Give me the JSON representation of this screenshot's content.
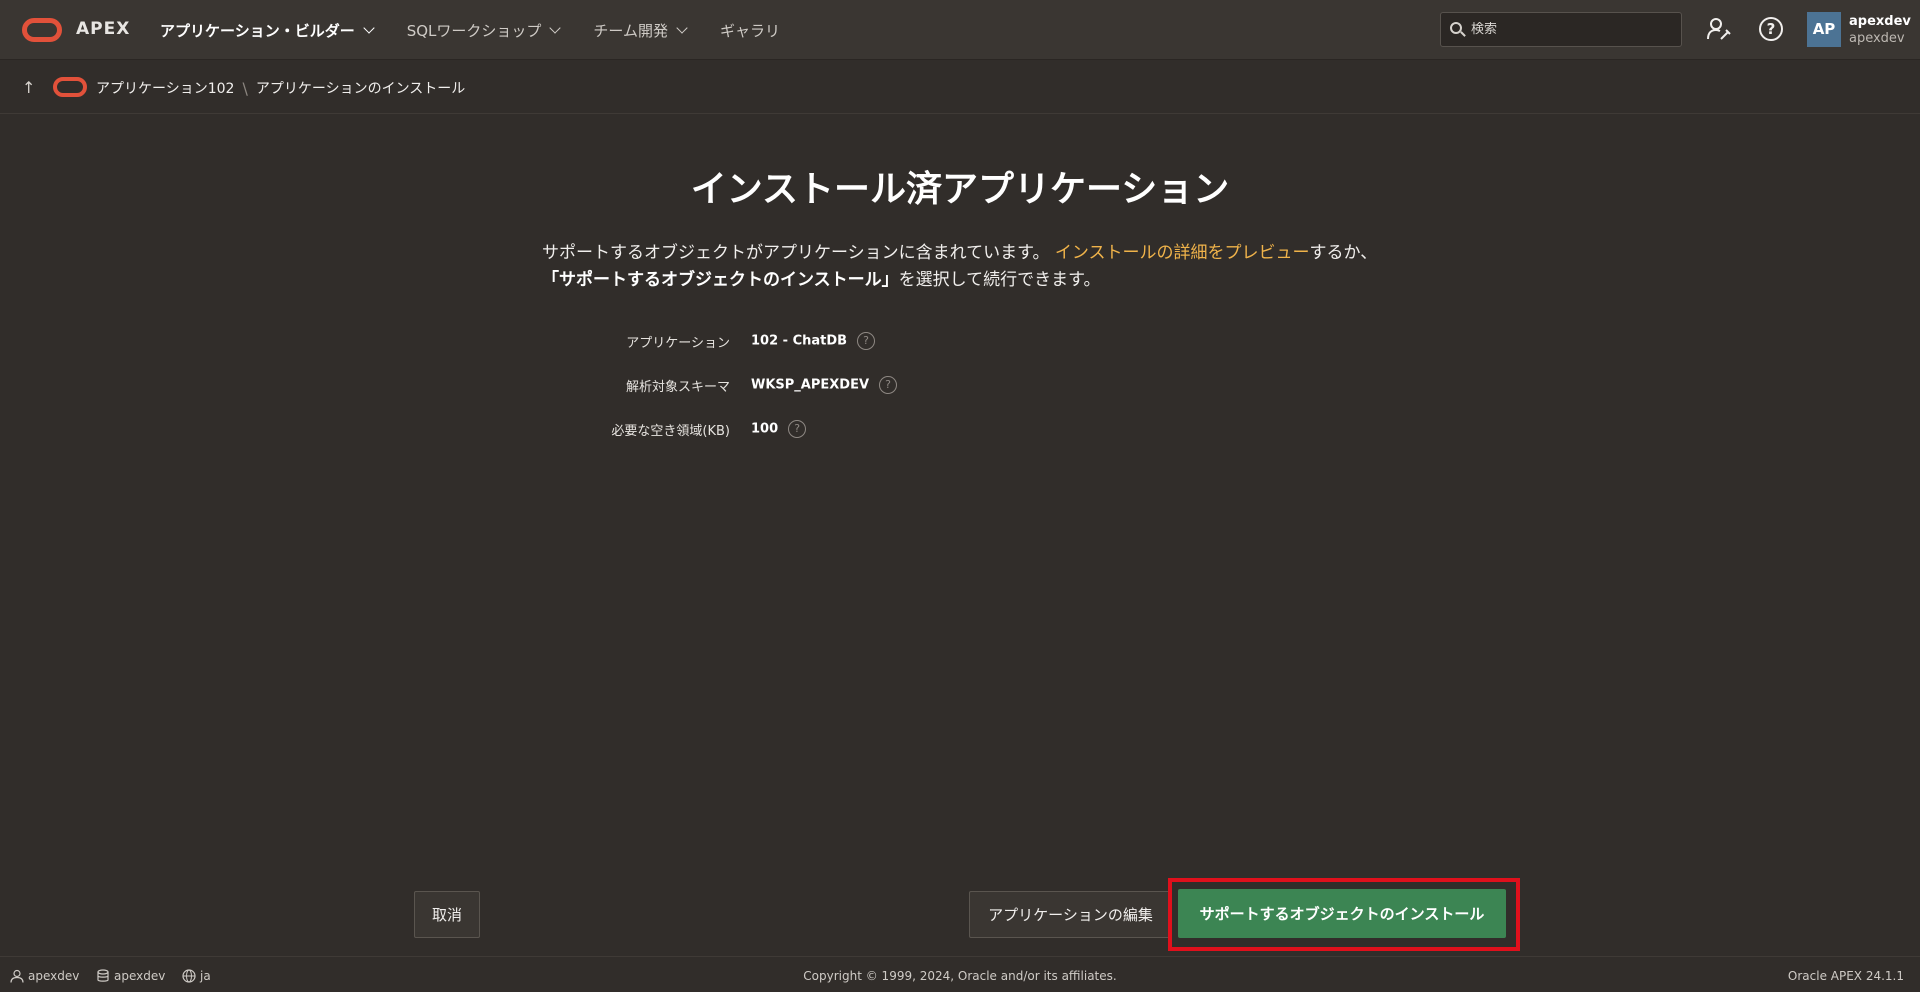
{
  "header": {
    "app_name": "APEX",
    "nav": [
      {
        "label": "アプリケーション・ビルダー"
      },
      {
        "label": "SQLワークショップ"
      },
      {
        "label": "チーム開発"
      },
      {
        "label": "ギャラリ"
      }
    ],
    "search_placeholder": "検索",
    "avatar_initials": "AP",
    "user_name": "apexdev",
    "workspace": "apexdev"
  },
  "breadcrumb": {
    "items": [
      "アプリケーション102",
      "アプリケーションのインストール"
    ]
  },
  "main": {
    "title": "インストール済アプリケーション",
    "desc_part1": "サポートするオブジェクトがアプリケーションに含まれています。",
    "desc_link": "インストールの詳細をプレビュー",
    "desc_part2": "するか、",
    "desc_strong": "「サポートするオブジェクトのインストール」",
    "desc_part3": "を選択して続行できます。",
    "fields": [
      {
        "label": "アプリケーション",
        "value": "102 - ChatDB"
      },
      {
        "label": "解析対象スキーマ",
        "value": "WKSP_APEXDEV"
      },
      {
        "label": "必要な空き領域(KB)",
        "value": "100"
      }
    ],
    "help_glyph": "?"
  },
  "buttons": {
    "cancel": "取消",
    "edit": "アプリケーションの編集",
    "install": "サポートするオブジェクトのインストール"
  },
  "footer": {
    "user": "apexdev",
    "workspace": "apexdev",
    "language": "ja",
    "copyright": "Copyright © 1999, 2024, Oracle and/or its affiliates.",
    "version": "Oracle APEX 24.1.1"
  },
  "colors": {
    "background": "#312d2a",
    "header": "#3a3632",
    "accent_link": "#f0b34a",
    "install_button": "#3c8553",
    "highlight_border": "#e0101c",
    "logo": "#e2513a"
  }
}
